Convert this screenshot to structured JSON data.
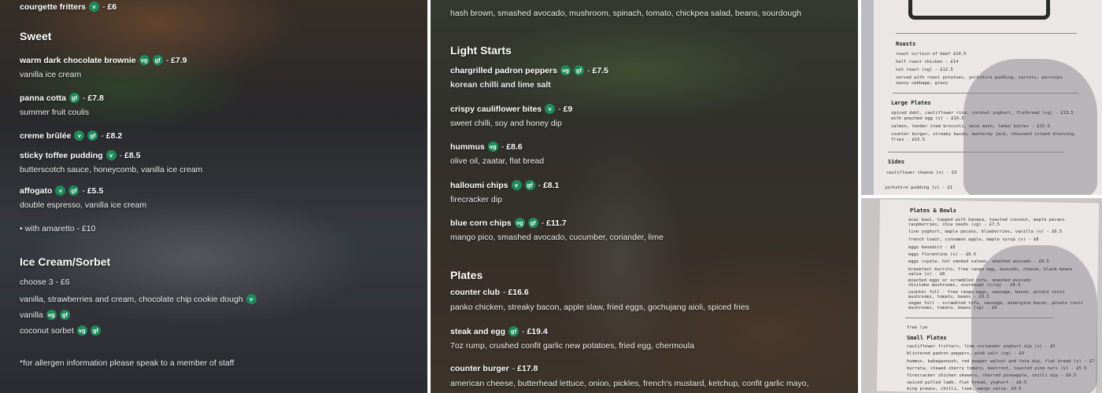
{
  "left": {
    "top_item": {
      "name": "courgette fritters",
      "badges": [
        "v"
      ],
      "price": "£6"
    },
    "sweet": {
      "heading": "Sweet",
      "items": [
        {
          "name": "warm dark chocolate brownie",
          "badges": [
            "vg",
            "gf"
          ],
          "price": "£7.9",
          "desc": "vanilla ice cream"
        },
        {
          "name": "panna cotta",
          "badges": [
            "gf"
          ],
          "price": "£7.8",
          "desc": "summer fruit coulis"
        },
        {
          "name": "creme brûlée",
          "badges": [
            "v",
            "gf"
          ],
          "price": "£8.2",
          "desc": ""
        },
        {
          "name": "sticky toffee pudding",
          "badges": [
            "v"
          ],
          "price": "£8.5",
          "desc": "butterscotch sauce, honeycomb, vanilla ice cream"
        },
        {
          "name": "affogato",
          "badges": [
            "v",
            "gf"
          ],
          "price": "£5.5",
          "desc": "double espresso, vanilla ice cream"
        }
      ],
      "addon": "• with amaretto - £10"
    },
    "icecream": {
      "heading": "Ice Cream/Sorbet",
      "choose": "choose 3 - £6",
      "flavours": [
        {
          "name": "vanilla, strawberries and cream, chocolate chip cookie dough",
          "badges": [
            "v"
          ]
        },
        {
          "name": "vanilla",
          "badges": [
            "vg",
            "gf"
          ]
        },
        {
          "name": "coconut sorbet",
          "badges": [
            "vg",
            "gf"
          ]
        }
      ]
    },
    "allergen_note": "*for allergen information please speak to a member of staff"
  },
  "middle": {
    "top_desc": "hash brown, smashed avocado, mushroom, spinach, tomato, chickpea salad, beans, sourdough",
    "light_starts": {
      "heading": "Light Starts",
      "items": [
        {
          "name": "chargrilled padron peppers",
          "badges": [
            "vg",
            "gf"
          ],
          "price": "£7.5",
          "desc": "korean chilli and lime salt"
        },
        {
          "name": "crispy cauliflower bites",
          "badges": [
            "v"
          ],
          "price": "£9",
          "desc": "sweet chilli, soy and honey dip"
        },
        {
          "name": "hummus",
          "badges": [
            "vg"
          ],
          "price": "£8.6",
          "desc": "olive oil, zaatar, flat bread"
        },
        {
          "name": "halloumi chips",
          "badges": [
            "v",
            "gf"
          ],
          "price": "£8.1",
          "desc": "firecracker dip"
        },
        {
          "name": "blue corn chips",
          "badges": [
            "vg",
            "gf"
          ],
          "price": "£11.7",
          "desc": "mango pico, smashed avocado, cucumber, coriander, lime"
        }
      ]
    },
    "plates": {
      "heading": "Plates",
      "items": [
        {
          "name": "counter club",
          "badges": [],
          "price": "£16.6",
          "desc": "panko chicken, streaky bacon, apple slaw, fried eggs, gochujang aioli, spiced fries"
        },
        {
          "name": "steak and egg",
          "badges": [
            "gf"
          ],
          "price": "£19.4",
          "desc": "7oz rump, crushed confit garlic new potatoes, fried egg, chermoula"
        },
        {
          "name": "counter burger",
          "badges": [],
          "price": "£17.8",
          "desc": "american cheese, butterhead lettuce, onion, pickles, french's mustard, ketchup, confit garlic mayo,"
        }
      ]
    }
  },
  "photo_top": {
    "roasts_heading": "Roasts",
    "roasts": [
      "roast sirloin of beef £14.5",
      "half roast chicken - £14",
      "nut roast (vg) - £12.5",
      "served with roast potatoes, yorkshire pudding, carrots, parsnips",
      "savoy cabbage, gravy"
    ],
    "large_heading": "Large Plates",
    "large": [
      "spiced dahl, cauliflower rice, coconut yoghurt, flatbread (vg) - £13.5",
      "with poached egg (v) - £14.5",
      "salmon, tender stem broccoli, miso mash, lemon butter - £15.5",
      "counter burger, streaky bacon, monterey jack, thousand island dressing,",
      "fries - £15.5"
    ],
    "sides_heading": "Sides",
    "sides": [
      "cauliflower cheese (v) - £3",
      "yorkshire pudding (v) - £1"
    ]
  },
  "photo_bottom": {
    "plates_heading": "Plates & Bowls",
    "plates": [
      "acai bowl, topped with banana, toasted coconut, maple pecans",
      "raspberries, chia seeds (vg) - £7.5",
      "live yoghurt, maple pecans, blueberries, vanilla (v) - £6.5",
      "french toast, cinnamon apple, maple syrup (v) - £8",
      "eggs benedict - £8",
      "eggs florentine (v) - £8.5",
      "eggs royale, hot smoked salmon, smashed avocado - £9.5",
      "breakfast burrito, free range egg, avocado, cheese, black beans",
      "salsa (v) - £8",
      "poached eggs or scrambled tofu, smashed avocado",
      "shiitake mushrooms, sourdough (v/vg) - £8.5",
      "counter full - free range eggs, sausage, bacon, potato rosti",
      "mushrooms, tomato, beans - £9.5",
      "vegan full - scrambled tofu, sausage, aubergine bacon, potato rosti",
      "mushrooms, tomato, beans (vg) - £9"
    ],
    "free_note": "free lye",
    "small_heading": "Small Plates",
    "small": [
      "cauliflower fritters, lime coriander yoghurt dip (v) - £5",
      "blistered padron peppers, pink salt (vg) - £4",
      "hummus, babaganoush, red pepper walnut and feta dip, flat bread (v) - £7",
      "burrata, stewed cherry tomato, beetroot, toasted pine nuts (v) - £5.5",
      "firecracker chicken skewers, charred pineapple, chilli dip - £9.5",
      "spiced pulled lamb, flat bread, yoghurt - £8.5",
      "king prawns, chilli, lime, mango salsa- £9.5"
    ]
  }
}
